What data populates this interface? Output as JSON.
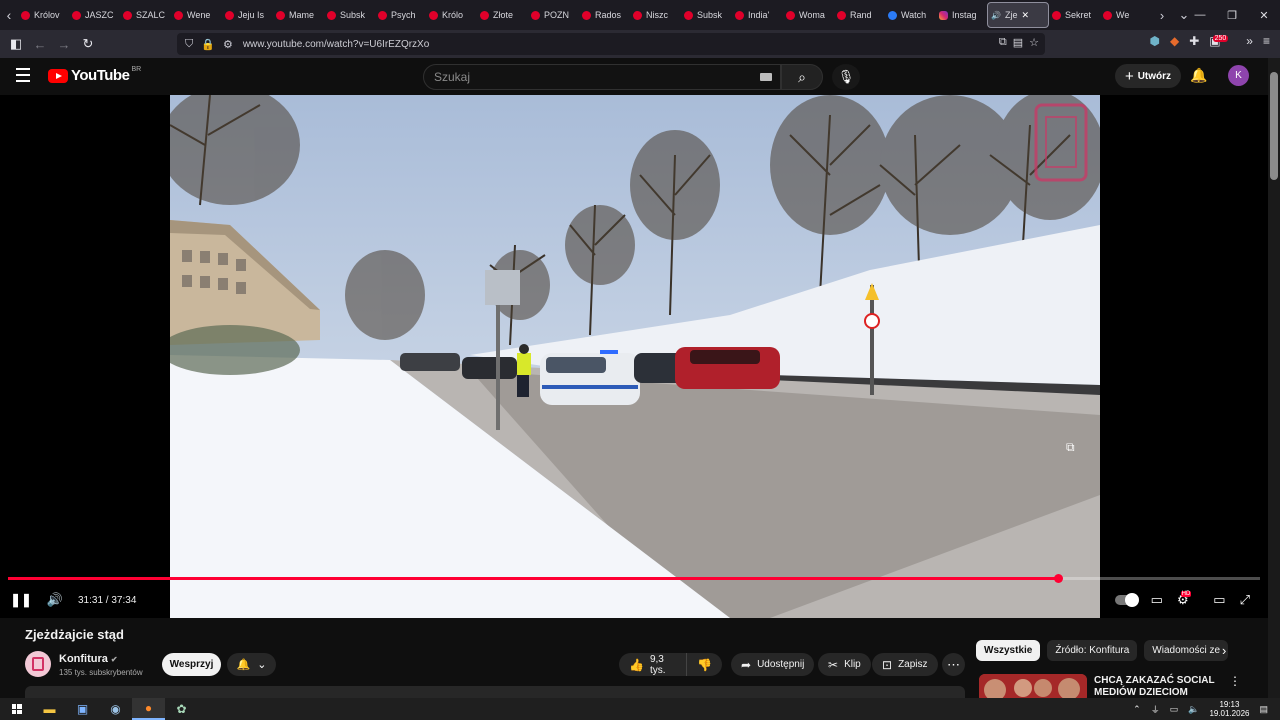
{
  "browser": {
    "tabs": [
      {
        "label": "Królov",
        "favicon": "youtube-icon"
      },
      {
        "label": "JASZC",
        "favicon": "youtube-icon"
      },
      {
        "label": "SZALC",
        "favicon": "youtube-icon"
      },
      {
        "label": "Wene",
        "favicon": "youtube-icon"
      },
      {
        "label": "Jeju Is",
        "favicon": "youtube-icon"
      },
      {
        "label": "Mame",
        "favicon": "youtube-icon"
      },
      {
        "label": "Subsk",
        "favicon": "youtube-icon"
      },
      {
        "label": "Psych",
        "favicon": "youtube-icon"
      },
      {
        "label": "Królo",
        "favicon": "youtube-icon"
      },
      {
        "label": "Złote",
        "favicon": "youtube-icon"
      },
      {
        "label": "POZN",
        "favicon": "youtube-icon"
      },
      {
        "label": "Rados",
        "favicon": "youtube-icon"
      },
      {
        "label": "Niszc",
        "favicon": "youtube-icon"
      },
      {
        "label": "Subsk",
        "favicon": "youtube-icon"
      },
      {
        "label": "India'",
        "favicon": "youtube-icon"
      },
      {
        "label": "Woma",
        "favicon": "youtube-icon"
      },
      {
        "label": "Rand",
        "favicon": "youtube-icon"
      },
      {
        "label": "Watch",
        "favicon": "meta-icon"
      },
      {
        "label": "Instag",
        "favicon": "instagram-icon"
      }
    ],
    "active_tab": {
      "label": "Zje"
    },
    "tabs_after": [
      {
        "label": "Sekret",
        "favicon": "youtube-icon"
      },
      {
        "label": "We",
        "favicon": "youtube-icon"
      }
    ],
    "url": "www.youtube.com/watch?v=U6IrEZQrzXo",
    "extensions_badge": "250"
  },
  "header": {
    "logo_text": "YouTube",
    "country_code": "BR",
    "search_placeholder": "Szukaj",
    "create_label": "Utwórz",
    "avatar_letter": "K"
  },
  "player": {
    "current_time": "31:31",
    "duration": "37:34",
    "time_display": "31:31 / 37:34",
    "progress_fraction": 0.839,
    "hd_badge": "HD",
    "colors": {
      "progress": "#ff0033"
    }
  },
  "video": {
    "title": "Zjeżdżajcie stąd",
    "channel_name": "Konfitura",
    "subscribers": "135 tys. subskrybentów",
    "support_label": "Wesprzyj",
    "likes": "9,3 tys.",
    "share_label": "Udostępnij",
    "clip_label": "Klip",
    "save_label": "Zapisz"
  },
  "sidebar": {
    "chips": [
      "Wszystkie",
      "Źródło: Konfitura",
      "Wiadomości ze"
    ],
    "recommendation_title": "CHCĄ ZAKAZAĆ SOCIAL MEDIÓW DZIECIOM"
  },
  "taskbar": {
    "time": "19:13",
    "date": "19.01.2026"
  }
}
